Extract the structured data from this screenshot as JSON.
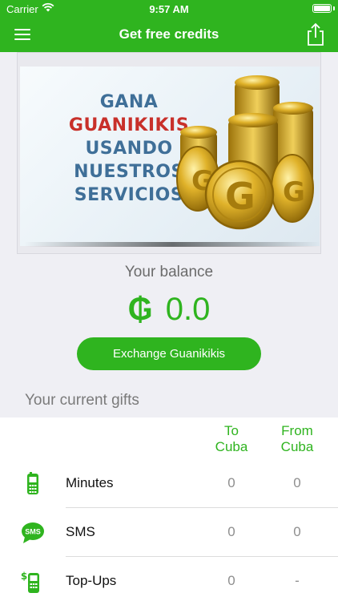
{
  "status_bar": {
    "carrier": "Carrier",
    "time": "9:57 AM"
  },
  "nav": {
    "title": "Get free credits",
    "menu_icon": "hamburger-menu-icon",
    "share_icon": "share-icon"
  },
  "banner": {
    "line1": "GANA",
    "line2": "GUANIKIKIS",
    "line3": "USANDO",
    "line4": "NUESTROS",
    "line5": "SERVICIOS"
  },
  "balance": {
    "label": "Your balance",
    "currency_symbol": "₲",
    "amount": "0.0"
  },
  "exchange_button": "Exchange Guanikikis",
  "gifts": {
    "title": "Your current gifts",
    "columns": [
      {
        "line1": "To",
        "line2": "Cuba"
      },
      {
        "line1": "From",
        "line2": "Cuba"
      }
    ],
    "rows": [
      {
        "label": "Minutes",
        "icon": "mobile-phone-icon",
        "to_cuba": "0",
        "from_cuba": "0"
      },
      {
        "label": "SMS",
        "icon": "sms-bubble-icon",
        "to_cuba": "0",
        "from_cuba": "0"
      },
      {
        "label": "Top-Ups",
        "icon": "phone-topup-icon",
        "to_cuba": "0",
        "from_cuba": "-"
      }
    ]
  },
  "colors": {
    "accent": "#2fb41f",
    "brand_red": "#c8302a",
    "promo_blue": "#3f6f98"
  }
}
